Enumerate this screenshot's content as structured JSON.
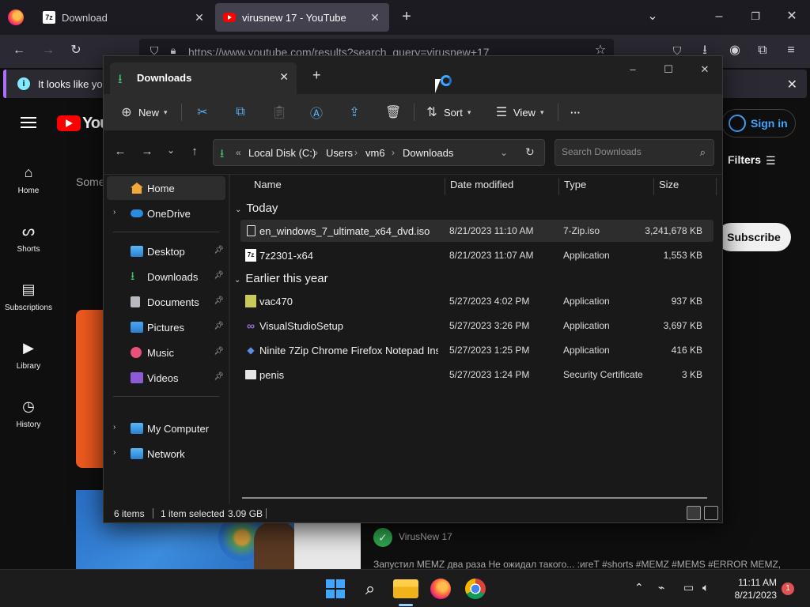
{
  "browser": {
    "tabs": [
      {
        "label": "Download",
        "favicon": "7zip-icon"
      },
      {
        "label": "virusnew 17 - YouTube",
        "favicon": "youtube-icon"
      }
    ],
    "url": "https://www.youtube.com/results?search_query=virusnew+17",
    "notice": "It looks like you"
  },
  "youtube": {
    "logo_text": "You",
    "sidebar": [
      {
        "label": "Home",
        "icon": "home-icon"
      },
      {
        "label": "Shorts",
        "icon": "shorts-icon"
      },
      {
        "label": "Subscriptions",
        "icon": "subscriptions-icon"
      },
      {
        "label": "Library",
        "icon": "library-icon"
      },
      {
        "label": "History",
        "icon": "history-icon"
      }
    ],
    "some_text": "Some",
    "sign_in": "Sign in",
    "filters": "Filters",
    "subscribe": "Subscribe",
    "channel_name": "VirusNew 17",
    "description": "Запустил MEMZ два раза Не ожидал такого... :игеТ #shorts #MEMZ #MEMS #ERROR MEMZ,"
  },
  "explorer": {
    "tab_title": "Downloads",
    "toolbar": {
      "new": "New",
      "sort": "Sort",
      "view": "View",
      "more": "···"
    },
    "breadcrumb": [
      "Local Disk (C:)",
      "Users",
      "vm6",
      "Downloads"
    ],
    "search_placeholder": "Search Downloads",
    "nav": {
      "home": "Home",
      "onedrive": "OneDrive",
      "quick": [
        "Desktop",
        "Downloads",
        "Documents",
        "Pictures",
        "Music",
        "Videos"
      ],
      "my_computer": "My Computer",
      "network": "Network"
    },
    "columns": {
      "name": "Name",
      "date": "Date modified",
      "type": "Type",
      "size": "Size"
    },
    "groups": [
      {
        "label": "Today",
        "files": [
          {
            "name": "en_windows_7_ultimate_x64_dvd.iso",
            "date": "8/21/2023 11:10 AM",
            "type": "7-Zip.iso",
            "size": "3,241,678 KB",
            "selected": true,
            "icon": "iso-file-icon"
          },
          {
            "name": "7z2301-x64",
            "date": "8/21/2023 11:07 AM",
            "type": "Application",
            "size": "1,553 KB",
            "selected": false,
            "icon": "7zip-installer-icon"
          }
        ]
      },
      {
        "label": "Earlier this year",
        "files": [
          {
            "name": "vac470",
            "date": "5/27/2023 4:02 PM",
            "type": "Application",
            "size": "937 KB",
            "selected": false,
            "icon": "app-icon"
          },
          {
            "name": "VisualStudioSetup",
            "date": "5/27/2023 3:26 PM",
            "type": "Application",
            "size": "3,697 KB",
            "selected": false,
            "icon": "visual-studio-icon"
          },
          {
            "name": "Ninite 7Zip Chrome Firefox Notepad Inst...",
            "date": "5/27/2023 1:25 PM",
            "type": "Application",
            "size": "416 KB",
            "selected": false,
            "icon": "ninite-icon"
          },
          {
            "name": "penis",
            "date": "5/27/2023 1:24 PM",
            "type": "Security Certificate",
            "size": "3 KB",
            "selected": false,
            "icon": "certificate-icon"
          }
        ]
      }
    ],
    "status": {
      "items": "6 items",
      "selected": "1 item selected",
      "size": "3.09 GB"
    }
  },
  "taskbar": {
    "time": "11:11 AM",
    "date": "8/21/2023",
    "notifications": "1"
  },
  "colors": {
    "accent": "#3fa7ff",
    "youtube_red": "#ff0000",
    "folder_green": "#3cc06f"
  }
}
